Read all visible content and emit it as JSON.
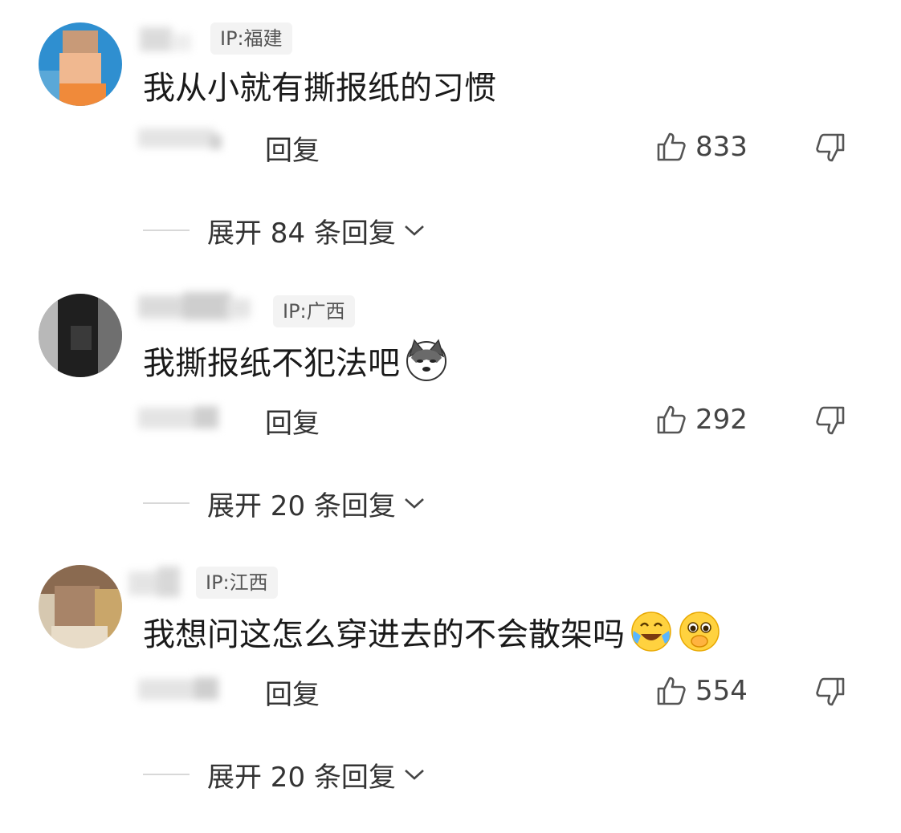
{
  "comments": [
    {
      "ip": "IP:福建",
      "text": "我从小就有撕报纸的习惯",
      "emojis": [],
      "reply_label": "回复",
      "likes": "833",
      "expand_label": "展开 84 条回复"
    },
    {
      "ip": "IP:广西",
      "text": "我撕报纸不犯法吧",
      "emojis": [
        "husky-doge-emoji"
      ],
      "reply_label": "回复",
      "likes": "292",
      "expand_label": "展开 20 条回复"
    },
    {
      "ip": "IP:江西",
      "text": "我想问这怎么穿进去的不会散架吗",
      "emojis": [
        "laugh-cry-emoji",
        "pleading-emoji"
      ],
      "reply_label": "回复",
      "likes": "554",
      "expand_label": "展开 20 条回复"
    }
  ],
  "icons": {
    "like": "thumbs-up-icon",
    "dislike": "thumbs-down-icon",
    "expand": "chevron-down-icon"
  }
}
